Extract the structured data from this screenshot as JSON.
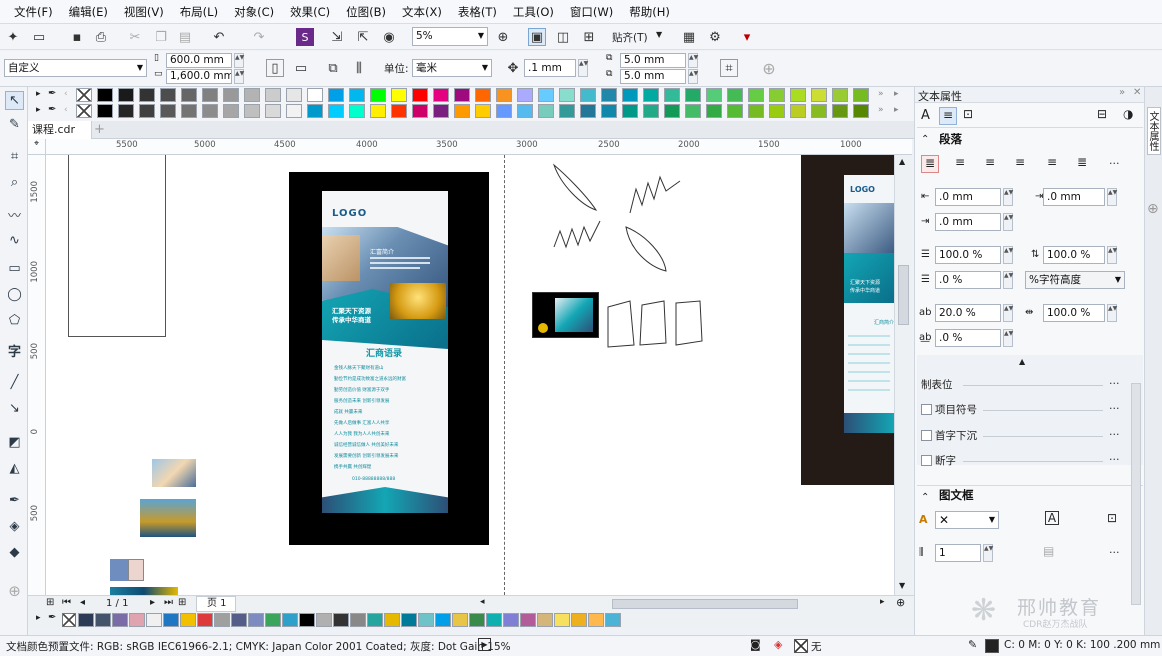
{
  "menu": [
    "文件(F)",
    "编辑(E)",
    "视图(V)",
    "布局(L)",
    "对象(C)",
    "效果(C)",
    "位图(B)",
    "文本(X)",
    "表格(T)",
    "工具(O)",
    "窗口(W)",
    "帮助(H)"
  ],
  "toolbar1": {
    "zoom_value": "5%",
    "snap_label": "贴齐(T)"
  },
  "toolbar2": {
    "preset": "自定义",
    "width": "600.0 mm",
    "height": "1,600.0 mm",
    "unit_label": "单位:",
    "unit_value": "毫米",
    "nudge": ".1 mm",
    "dup_x": "5.0 mm",
    "dup_y": "5.0 mm"
  },
  "document_tab": "课程.cdr",
  "ruler_h_labels": [
    "5500",
    "5000",
    "4500",
    "4000",
    "3500",
    "3000",
    "2500",
    "2000",
    "1500",
    "1000"
  ],
  "ruler_v_labels": [
    "1500",
    "1000",
    "500",
    "0",
    "500"
  ],
  "page_nav": {
    "page_count": "1 / 1",
    "page_name": "页 1"
  },
  "canvas": {
    "flyer": {
      "logo": "LOGO",
      "intro_title": "汇富简介",
      "slogan_line1": "汇聚天下资源",
      "slogan_line2": "传承中华商道",
      "quotes_title": "汇商语录",
      "quotes": [
        "金钱人脉天下聚财有道山",
        "勤俭节约是成功致富之道永远的财富",
        "勤劳创造价值 财富源于双手",
        "服务创造未来 创新引领发展",
        "成就 共赢未来",
        "先做人后做事 汇富人人共享",
        "人人为我 我为人人共创未来",
        "诚信经营诚信做人 共创美好未来",
        "发展需要创新 创新引领发展未来",
        "携手共赢 共创辉煌"
      ],
      "phone": "010-88888888/888"
    },
    "right_flyer": {
      "logo": "LOGO",
      "slogan": "汇聚天下资源",
      "slogan2": "传承中华商道",
      "intro": "汇商简介"
    }
  },
  "status": {
    "profile": "文档颜色预置文件: RGB: sRGB IEC61966-2.1; CMYK: Japan Color 2001 Coated; 灰度: Dot Gain 15%",
    "fill_none": "无",
    "outline": "C: 0 M: 0 Y: 0 K: 100  .200 mm"
  },
  "panel": {
    "title": "文本属性",
    "paragraph": "段落",
    "indent_left": ".0 mm",
    "indent_right": ".0 mm",
    "indent_first": ".0 mm",
    "line_spacing": "100.0 %",
    "char_spacing": "100.0 %",
    "before_para": ".0 %",
    "spacing_unit": "%字符高度",
    "lang_spacing": "20.0 %",
    "word_spacing": "100.0 %",
    "char_spacing2": ".0 %",
    "tabs": "制表位",
    "bullets": "项目符号",
    "dropcap": "首字下沉",
    "hyphen": "断字",
    "frame": "图文框",
    "columns": "1",
    "watermark": "邢帅教育",
    "watermark_sub": "CDR赵万杰战队"
  },
  "sidetab": "文本属性",
  "colors": {
    "top_row": [
      "#000000",
      "#1a1a1a",
      "#333333",
      "#4d4d4d",
      "#666666",
      "#808080",
      "#999999",
      "#b3b3b3",
      "#cccccc",
      "#e6e6e6",
      "#ffffff",
      "#00a0e9",
      "#00b7ee",
      "#00ff00",
      "#ffff00",
      "#ff0000",
      "#e4007f",
      "#9e0b7f",
      "#ff6600",
      "#f7931e",
      "#aaaaff",
      "#66ccff",
      "#88ddcc",
      "#44bbcc",
      "#2288aa",
      "#0099bb",
      "#00aaa0",
      "#33bb99",
      "#22aa66",
      "#55cc77",
      "#44bb55",
      "#66cc44",
      "#88cc33",
      "#aadd22",
      "#ccdd33",
      "#99cc33",
      "#77bb22"
    ],
    "second_row": [
      "#000000",
      "#262626",
      "#404040",
      "#595959",
      "#737373",
      "#8c8c8c",
      "#a6a6a6",
      "#bfbfbf",
      "#d9d9d9",
      "#f2f2f2",
      "#0099cc",
      "#00ccff",
      "#00ffcc",
      "#ffee00",
      "#ff3300",
      "#cc0066",
      "#7a1f80",
      "#ff9900",
      "#ffcc00",
      "#6699ff",
      "#55bbee",
      "#77ccbb",
      "#339999",
      "#227799",
      "#1188aa",
      "#009988",
      "#22aa88",
      "#119955",
      "#44bb66",
      "#33aa44",
      "#55bb33",
      "#77bb22",
      "#99cc11",
      "#bbcc22",
      "#88bb22",
      "#669911",
      "#558800"
    ],
    "bottom_row": [
      "#2b3a55",
      "#44546a",
      "#7b6ca7",
      "#e0a4b0",
      "#f0f0f0",
      "#1f76c2",
      "#f3c000",
      "#dd3b3b",
      "#9f9f9f",
      "#555e88",
      "#7d8cc0",
      "#3ba55c",
      "#2ea0c9",
      "#000000",
      "#b0b0b0",
      "#333333",
      "#888888",
      "#25a5a0",
      "#e6b800",
      "#007a99",
      "#6ec2c8",
      "#00a0e9",
      "#e8c547",
      "#3a8a4a",
      "#10b0b0",
      "#7f7fd5",
      "#b35c9a",
      "#d4b67a",
      "#f7e05e",
      "#efb020",
      "#ffb84d",
      "#4bb3d6"
    ],
    "accent": "#1d8fcf"
  }
}
